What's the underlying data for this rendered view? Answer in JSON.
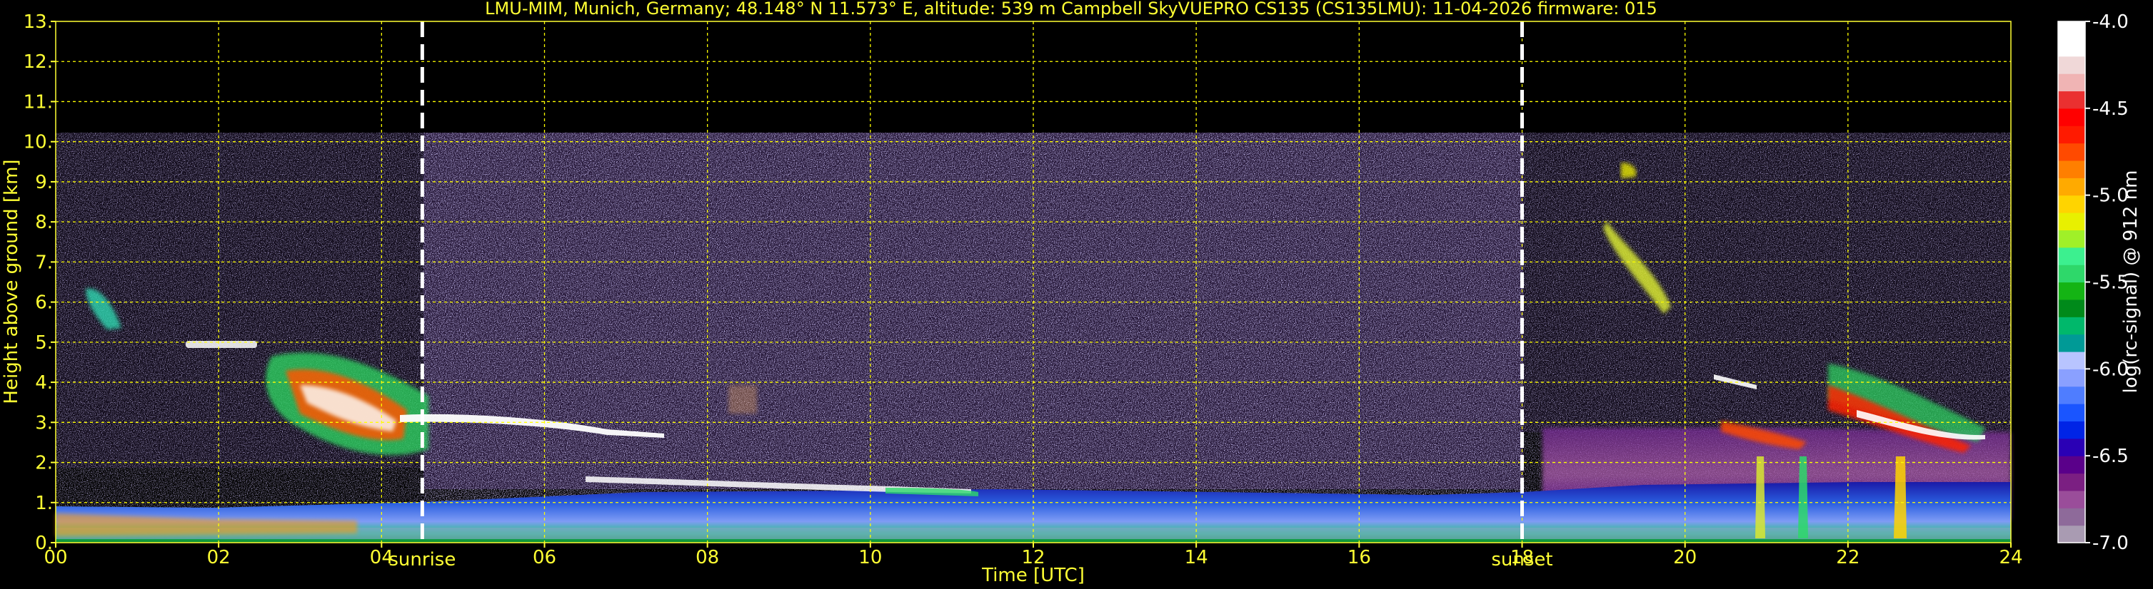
{
  "chart_data": {
    "type": "heatmap",
    "title": "LMU-MIM, Munich, Germany; 48.148° N 11.573° E, altitude: 539 m    Campbell SkyVUEPRO CS135 (CS135LMU): 11-04-2026    firmware: 015",
    "xlabel": "Time [UTC]",
    "ylabel": "Height above ground [km]",
    "xlim": [
      0,
      24
    ],
    "ylim": [
      0,
      13
    ],
    "x_ticks": [
      "00",
      "02",
      "04",
      "06",
      "08",
      "10",
      "12",
      "14",
      "16",
      "18",
      "20",
      "22",
      "24"
    ],
    "y_ticks": [
      "0.",
      "1.",
      "2.",
      "3.",
      "4.",
      "5.",
      "6.",
      "7.",
      "8.",
      "9.",
      "10.",
      "11.",
      "12.",
      "13."
    ],
    "grid": true,
    "annotations": [
      {
        "label": "sunrise",
        "time_utc": 4.5
      },
      {
        "label": "sunset",
        "time_utc": 18.0
      }
    ],
    "data_ceiling_km": 10.2,
    "colorbar": {
      "label": "log(rc-signal) @ 912 nm",
      "range": [
        -7.0,
        -4.0
      ],
      "ticks": [
        "-4.0",
        "-4.5",
        "-5.0",
        "-5.5",
        "-6.0",
        "-6.5",
        "-7.0"
      ],
      "colors": [
        "#a99bb2",
        "#8e6a9a",
        "#9a4d9a",
        "#7b1f82",
        "#5a008a",
        "#2a00b5",
        "#0024e6",
        "#1a55ff",
        "#4f7dff",
        "#8aa0ff",
        "#b8c4ff",
        "#009a96",
        "#00b86b",
        "#008a1a",
        "#14b414",
        "#2ed86a",
        "#3cf08f",
        "#a0f028",
        "#e8f000",
        "#ffd400",
        "#ffaa00",
        "#ff7f00",
        "#ff4a00",
        "#ff1a00",
        "#ff0000",
        "#ea3030",
        "#f0b4b4",
        "#f0d8d8",
        "#ffffff",
        "#ffffff"
      ]
    },
    "features": [
      {
        "kind": "boundary layer aerosol",
        "time_utc": [
          0,
          24
        ],
        "height_km": [
          0,
          1.0
        ]
      },
      {
        "kind": "cloud layer",
        "time_utc": [
          1.2,
          4.3
        ],
        "height_km": [
          2.2,
          4.6
        ]
      },
      {
        "kind": "cloud base line",
        "time_utc": [
          4.2,
          7.5
        ],
        "height_km": [
          2.8,
          3.1
        ]
      },
      {
        "kind": "residual layer top",
        "time_utc": [
          4.5,
          11.3
        ],
        "height_km": [
          1.3,
          1.9
        ]
      },
      {
        "kind": "cirrus",
        "time_utc": [
          18.9,
          19.9
        ],
        "height_km": [
          5.6,
          8.2
        ]
      },
      {
        "kind": "cloud layer",
        "time_utc": [
          20.5,
          23.7
        ],
        "height_km": [
          2.2,
          4.5
        ]
      }
    ]
  }
}
